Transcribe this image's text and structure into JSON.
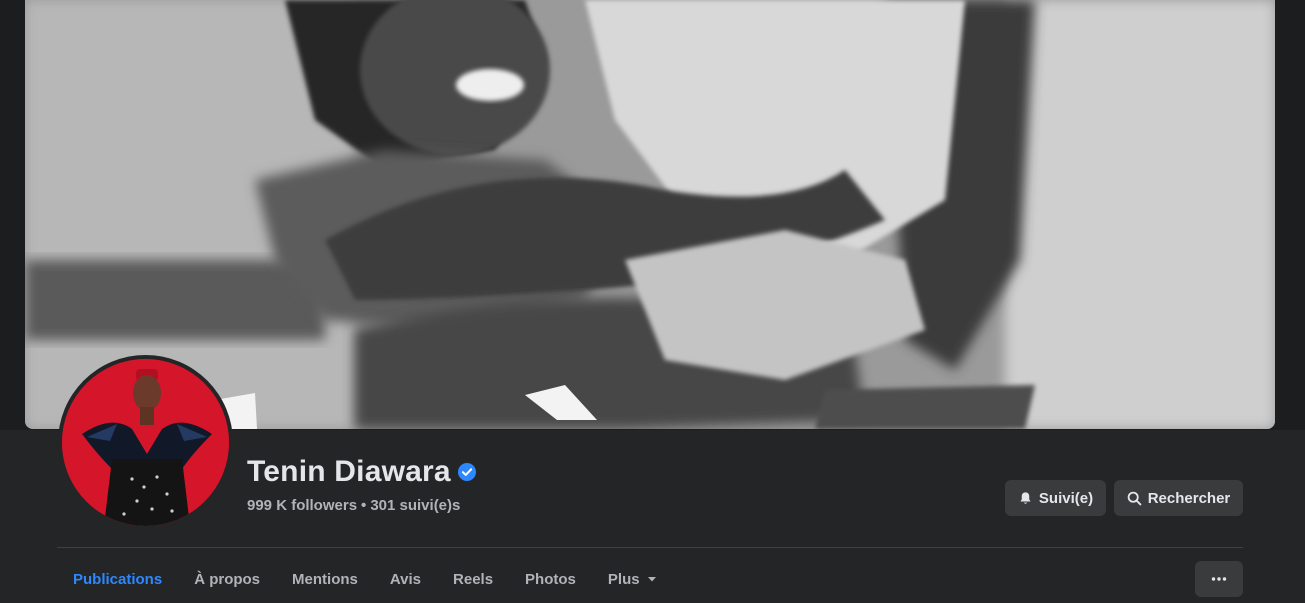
{
  "profile": {
    "name": "Tenin Diawara",
    "verified": true,
    "followers": "999 K followers",
    "separator": "•",
    "following": "301 suivi(e)s"
  },
  "actions": {
    "follow_label": "Suivi(e)",
    "search_label": "Rechercher"
  },
  "tabs": [
    {
      "label": "Publications",
      "active": true
    },
    {
      "label": "À propos",
      "active": false
    },
    {
      "label": "Mentions",
      "active": false
    },
    {
      "label": "Avis",
      "active": false
    },
    {
      "label": "Reels",
      "active": false
    },
    {
      "label": "Photos",
      "active": false
    },
    {
      "label": "Plus",
      "active": false
    }
  ],
  "icons": {
    "verified": "verified-badge-icon",
    "follow": "bell-icon",
    "search": "search-icon",
    "more_tab": "caret-down-icon",
    "overflow": "more-horizontal-icon"
  },
  "colors": {
    "background": "#18191a",
    "surface": "#242526",
    "button": "#3a3b3c",
    "text_primary": "#e4e6eb",
    "text_secondary": "#b0b3b8",
    "accent": "#2d88ff"
  }
}
